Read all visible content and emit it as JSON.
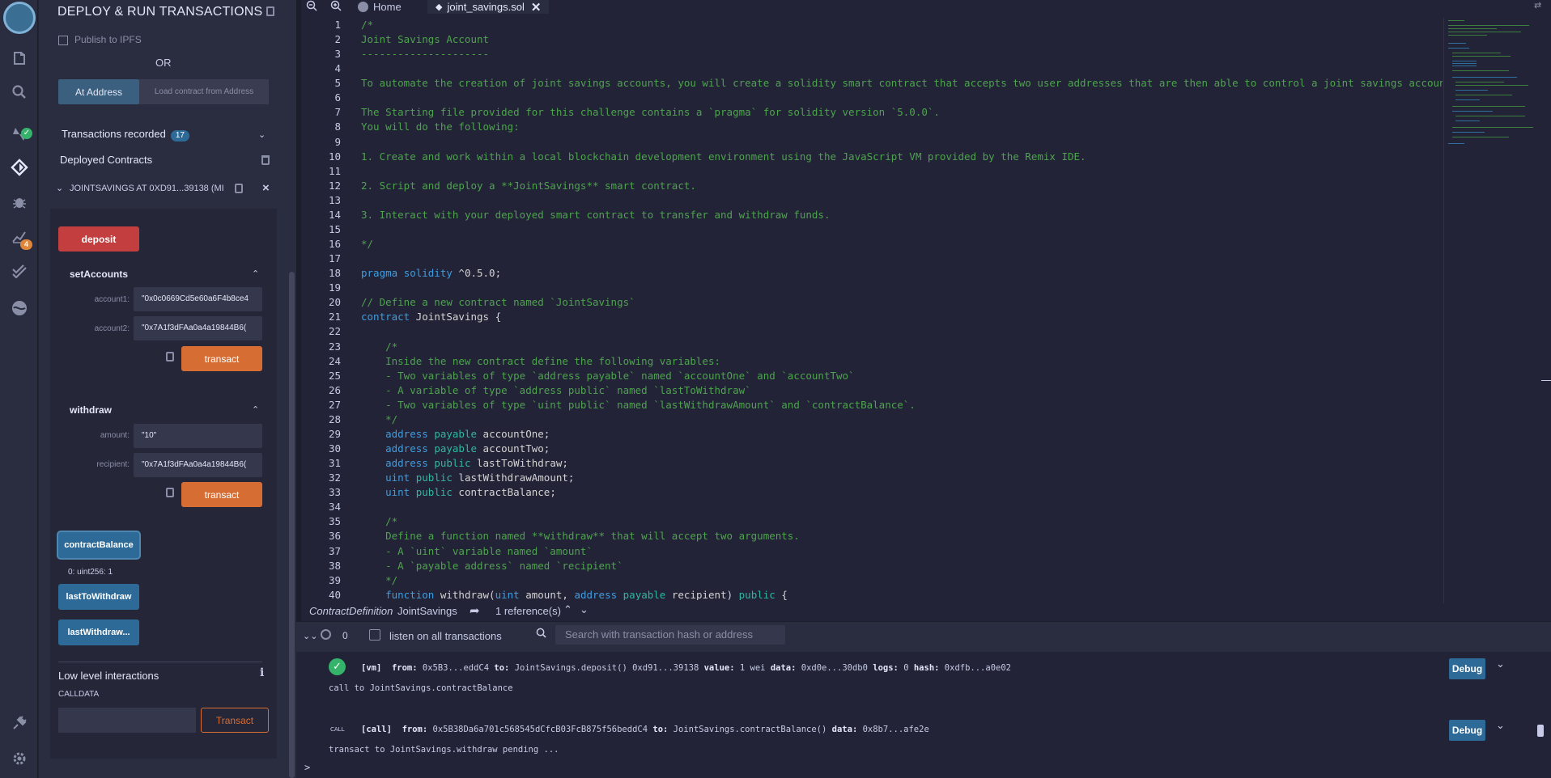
{
  "sidebar_icons": [
    {
      "name": "remix-logo-icon"
    },
    {
      "name": "file-explorer-icon"
    },
    {
      "name": "search-icon"
    },
    {
      "name": "solidity-compiler-icon"
    },
    {
      "name": "deploy-run-icon"
    },
    {
      "name": "debugger-icon"
    },
    {
      "name": "analysis-icon"
    },
    {
      "name": "unit-testing-icon"
    },
    {
      "name": "plugin-icon"
    },
    {
      "name": "plugin-manager-icon"
    },
    {
      "name": "settings-icon"
    }
  ],
  "sidebar_badges": {
    "analysis": "4"
  },
  "panel": {
    "title": "DEPLOY & RUN TRANSACTIONS",
    "publish_label": "Publish to IPFS",
    "or_text": "OR",
    "at_address_label": "At Address",
    "load_address_placeholder": "Load contract from Address",
    "transactions_recorded_label": "Transactions recorded",
    "transactions_recorded_count": "17",
    "deployed_contracts_label": "Deployed Contracts",
    "instance_label": "JOINTSAVINGS AT 0XD91...39138 (MI",
    "deposit_label": "deposit",
    "set_accounts": {
      "title": "setAccounts",
      "account1_label": "account1:",
      "account1_value": "\"0x0c0669Cd5e60a6F4b8ce4",
      "account2_label": "account2:",
      "account2_value": "\"0x7A1f3dFAa0a4a19844B6(",
      "transact_label": "transact"
    },
    "withdraw": {
      "title": "withdraw",
      "amount_label": "amount:",
      "amount_value": "\"10\"",
      "recipient_label": "recipient:",
      "recipient_value": "\"0x7A1f3dFAa0a4a19844B6(",
      "transact_label": "transact"
    },
    "contract_balance_label": "contractBalance",
    "contract_balance_result": "0: uint256: 1",
    "last_to_withdraw_label": "lastToWithdraw",
    "last_withdraw_amount_label": "lastWithdraw...",
    "low_level_label": "Low level interactions",
    "calldata_label": "CALLDATA",
    "low_level_transact_label": "Transact"
  },
  "tabs": {
    "home_label": "Home",
    "file_label": "joint_savings.sol"
  },
  "code_lines": [
    {
      "n": "1",
      "segs": [
        {
          "c": "c",
          "t": "/*"
        }
      ]
    },
    {
      "n": "2",
      "segs": [
        {
          "c": "c",
          "t": "Joint Savings Account"
        }
      ]
    },
    {
      "n": "3",
      "segs": [
        {
          "c": "c",
          "t": "---------------------"
        }
      ]
    },
    {
      "n": "4",
      "segs": []
    },
    {
      "n": "5",
      "segs": [
        {
          "c": "c",
          "t": "To automate the creation of joint savings accounts, you will create a solidity smart contract that accepts two user addresses that are then able to control a joint savings account. Your"
        }
      ]
    },
    {
      "n": "6",
      "segs": []
    },
    {
      "n": "7",
      "segs": [
        {
          "c": "c",
          "t": "The Starting file provided for this challenge contains a `pragma` for solidity version `5.0.0`."
        }
      ]
    },
    {
      "n": "8",
      "segs": [
        {
          "c": "c",
          "t": "You will do the following:"
        }
      ]
    },
    {
      "n": "9",
      "segs": []
    },
    {
      "n": "10",
      "segs": [
        {
          "c": "c",
          "t": "1. Create and work within a local blockchain development environment using the JavaScript VM provided by the Remix IDE."
        }
      ]
    },
    {
      "n": "11",
      "segs": []
    },
    {
      "n": "12",
      "segs": [
        {
          "c": "c",
          "t": "2. Script and deploy a **JointSavings** smart contract."
        }
      ]
    },
    {
      "n": "13",
      "segs": []
    },
    {
      "n": "14",
      "segs": [
        {
          "c": "c",
          "t": "3. Interact with your deployed smart contract to transfer and withdraw funds."
        }
      ]
    },
    {
      "n": "15",
      "segs": []
    },
    {
      "n": "16",
      "segs": [
        {
          "c": "c",
          "t": "*/"
        }
      ]
    },
    {
      "n": "17",
      "segs": []
    },
    {
      "n": "18",
      "segs": [
        {
          "c": "k",
          "t": "pragma"
        },
        {
          "c": "p",
          "t": " "
        },
        {
          "c": "k",
          "t": "solidity"
        },
        {
          "c": "p",
          "t": " ^0.5.0;"
        }
      ]
    },
    {
      "n": "19",
      "segs": []
    },
    {
      "n": "20",
      "segs": [
        {
          "c": "c",
          "t": "// Define a new contract named `JointSavings`"
        }
      ]
    },
    {
      "n": "21",
      "segs": [
        {
          "c": "k",
          "t": "contract"
        },
        {
          "c": "p",
          "t": " JointSavings {"
        }
      ]
    },
    {
      "n": "22",
      "segs": []
    },
    {
      "n": "23",
      "segs": [
        {
          "c": "c",
          "t": "    /*"
        }
      ]
    },
    {
      "n": "24",
      "segs": [
        {
          "c": "c",
          "t": "    Inside the new contract define the following variables:"
        }
      ]
    },
    {
      "n": "25",
      "segs": [
        {
          "c": "c",
          "t": "    - Two variables of type `address payable` named `accountOne` and `accountTwo`"
        }
      ]
    },
    {
      "n": "26",
      "segs": [
        {
          "c": "c",
          "t": "    - A variable of type `address public` named `lastToWithdraw`"
        }
      ]
    },
    {
      "n": "27",
      "segs": [
        {
          "c": "c",
          "t": "    - Two variables of type `uint public` named `lastWithdrawAmount` and `contractBalance`."
        }
      ]
    },
    {
      "n": "28",
      "segs": [
        {
          "c": "c",
          "t": "    */"
        }
      ]
    },
    {
      "n": "29",
      "segs": [
        {
          "c": "p",
          "t": "    "
        },
        {
          "c": "k",
          "t": "address"
        },
        {
          "c": "p",
          "t": " "
        },
        {
          "c": "t",
          "t": "payable"
        },
        {
          "c": "p",
          "t": " accountOne;"
        }
      ]
    },
    {
      "n": "30",
      "segs": [
        {
          "c": "p",
          "t": "    "
        },
        {
          "c": "k",
          "t": "address"
        },
        {
          "c": "p",
          "t": " "
        },
        {
          "c": "t",
          "t": "payable"
        },
        {
          "c": "p",
          "t": " accountTwo;"
        }
      ]
    },
    {
      "n": "31",
      "segs": [
        {
          "c": "p",
          "t": "    "
        },
        {
          "c": "k",
          "t": "address"
        },
        {
          "c": "p",
          "t": " "
        },
        {
          "c": "t",
          "t": "public"
        },
        {
          "c": "p",
          "t": " lastToWithdraw;"
        }
      ]
    },
    {
      "n": "32",
      "segs": [
        {
          "c": "p",
          "t": "    "
        },
        {
          "c": "k",
          "t": "uint"
        },
        {
          "c": "p",
          "t": " "
        },
        {
          "c": "t",
          "t": "public"
        },
        {
          "c": "p",
          "t": " lastWithdrawAmount;"
        }
      ]
    },
    {
      "n": "33",
      "segs": [
        {
          "c": "p",
          "t": "    "
        },
        {
          "c": "k",
          "t": "uint"
        },
        {
          "c": "p",
          "t": " "
        },
        {
          "c": "t",
          "t": "public"
        },
        {
          "c": "p",
          "t": " contractBalance;"
        }
      ]
    },
    {
      "n": "34",
      "segs": []
    },
    {
      "n": "35",
      "segs": [
        {
          "c": "c",
          "t": "    /*"
        }
      ]
    },
    {
      "n": "36",
      "segs": [
        {
          "c": "c",
          "t": "    Define a function named **withdraw** that will accept two arguments."
        }
      ]
    },
    {
      "n": "37",
      "segs": [
        {
          "c": "c",
          "t": "    - A `uint` variable named `amount`"
        }
      ]
    },
    {
      "n": "38",
      "segs": [
        {
          "c": "c",
          "t": "    - A `payable address` named `recipient`"
        }
      ]
    },
    {
      "n": "39",
      "segs": [
        {
          "c": "c",
          "t": "    */"
        }
      ]
    },
    {
      "n": "40",
      "segs": [
        {
          "c": "p",
          "t": "    "
        },
        {
          "c": "k",
          "t": "function"
        },
        {
          "c": "p",
          "t": " withdraw("
        },
        {
          "c": "k",
          "t": "uint"
        },
        {
          "c": "p",
          "t": " amount, "
        },
        {
          "c": "k",
          "t": "address"
        },
        {
          "c": "p",
          "t": " "
        },
        {
          "c": "t",
          "t": "payable"
        },
        {
          "c": "p",
          "t": " recipient) "
        },
        {
          "c": "t",
          "t": "public"
        },
        {
          "c": "p",
          "t": " {"
        }
      ]
    }
  ],
  "codelens": {
    "kind": "ContractDefinition",
    "name": "JointSavings",
    "refs": "1 reference(s)"
  },
  "terminal": {
    "pending_count": "0",
    "listen_label": "listen on all transactions",
    "search_placeholder": "Search with transaction hash or address",
    "call_icon_text": "CALL",
    "tx1": {
      "tag": "[vm]",
      "from_label": "from:",
      "from": "0x5B3...eddC4",
      "to_label": "to:",
      "to": "JointSavings.deposit() 0xd91...39138",
      "value_label": "value:",
      "value": "1 wei",
      "data_label": "data:",
      "data": "0xd0e...30db0",
      "logs_label": "logs:",
      "logs": "0",
      "hash_label": "hash:",
      "hash": "0xdfb...a0e02"
    },
    "line2": "call to JointSavings.contractBalance",
    "tx2": {
      "tag": "[call]",
      "from_label": "from:",
      "from": "0x5B38Da6a701c568545dCfcB03FcB875f56beddC4",
      "to_label": "to:",
      "to": "JointSavings.contractBalance()",
      "data_label": "data:",
      "data": "0x8b7...afe2e"
    },
    "line4": "transact to JointSavings.withdraw pending ...",
    "debug_label": "Debug",
    "prompt": ">"
  },
  "colors": {
    "background": "#222336",
    "panel": "#2a2c3f",
    "primary": "#2e6a98",
    "danger": "#c23e3f",
    "warning": "#d66e34",
    "success": "#35b36b",
    "comment": "#4ea34e",
    "keyword": "#3f9de0"
  }
}
